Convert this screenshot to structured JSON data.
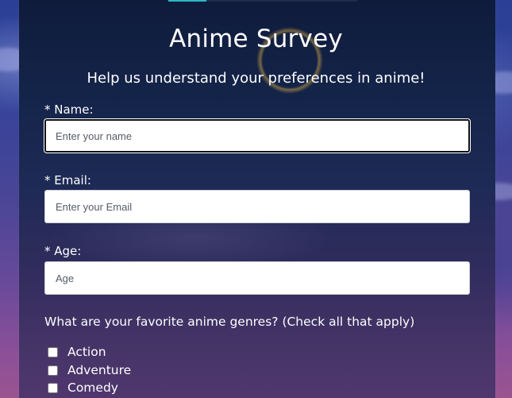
{
  "survey": {
    "title": "Anime Survey",
    "subtitle": "Help us understand your preferences in anime!"
  },
  "fields": {
    "name": {
      "label": "* Name:",
      "placeholder": "Enter your name",
      "value": ""
    },
    "email": {
      "label": "* Email:",
      "placeholder": "Enter your Email",
      "value": ""
    },
    "age": {
      "label": "* Age:",
      "placeholder": "Age",
      "value": ""
    }
  },
  "genres": {
    "question": "What are your favorite anime genres? (Check all that apply)",
    "options": [
      {
        "label": "Action",
        "checked": false
      },
      {
        "label": "Adventure",
        "checked": false
      },
      {
        "label": "Comedy",
        "checked": false
      }
    ]
  },
  "colors": {
    "accent": "#2bb8c8",
    "card_background": "#142449",
    "text": "#ffffff"
  }
}
